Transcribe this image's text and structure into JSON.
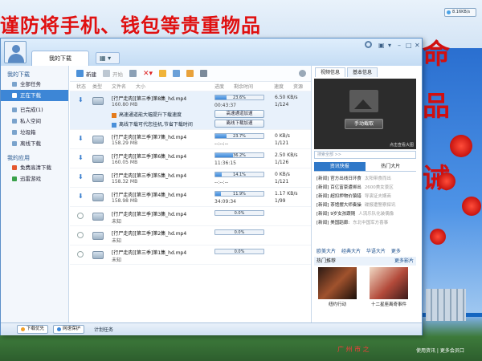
{
  "desktop": {
    "slogan": "谨防将手机、钱包等贵重物品",
    "big_chars": [
      "命",
      "品",
      "诫"
    ],
    "bottom_text": "广 州 市 之",
    "watermark": "S",
    "watermark_sub": "使用资讯 | 更多会员口"
  },
  "speed_widget": {
    "value": "8.16KB/s"
  },
  "window": {
    "tab_main": "我的下载",
    "tab_view_icon": "grid-icon"
  },
  "sidebar": {
    "my_downloads_header": "我的下载",
    "items": [
      {
        "label": "全部任务"
      },
      {
        "label": "正在下载"
      },
      {
        "label": "已完成(1)"
      },
      {
        "label": "私人空间"
      },
      {
        "label": "垃圾箱"
      },
      {
        "label": "离线下载"
      }
    ],
    "my_apps_header": "我的应用",
    "apps": [
      {
        "label": "免费高清下载"
      },
      {
        "label": "迅雷游戏"
      }
    ]
  },
  "toolbar": {
    "new_label": "新建",
    "start_label": "开始"
  },
  "columns": {
    "status": "状态",
    "type": "类型",
    "filename": "文件名",
    "size": "大小",
    "progress": "进度",
    "remaining": "剩余时间",
    "speed": "速度",
    "health": "资源"
  },
  "tasks": [
    {
      "name": "[行尸走肉][第三季]第8集_hd.mp4",
      "size": "160.80 MB",
      "progress": 23.6,
      "pct_label": "23.6%",
      "remaining": "00:43:37",
      "speed": "6.50 KB/s",
      "peers": "1/124",
      "state": "downloading"
    },
    {
      "name": "[行尸走肉][第三季]第7集_hd.mp4",
      "size": "158.29 MB",
      "progress": 23.7,
      "pct_label": "23.7%",
      "remaining": "--:--:--",
      "speed": "0 KB/s",
      "peers": "1/121",
      "state": "downloading"
    },
    {
      "name": "[行尸走肉][第三季]第6集_hd.mp4",
      "size": "160.05 MB",
      "progress": 36.2,
      "pct_label": "36.2%",
      "remaining": "11:36:15",
      "speed": "2.50 KB/s",
      "peers": "1/126",
      "state": "downloading"
    },
    {
      "name": "[行尸走肉][第三季]第5集_hd.mp4",
      "size": "158.32 MB",
      "progress": 14.1,
      "pct_label": "14.1%",
      "remaining": "--:--:--",
      "speed": "0 KB/s",
      "peers": "1/121",
      "state": "downloading"
    },
    {
      "name": "[行尸走肉][第三季]第4集_hd.mp4",
      "size": "158.98 MB",
      "progress": 11.9,
      "pct_label": "11.9%",
      "remaining": "34:09:34",
      "speed": "1.17 KB/s",
      "peers": "1/99",
      "state": "downloading"
    },
    {
      "name": "[行尸走肉][第三季]第3集_hd.mp4",
      "size": "未知",
      "progress": 0,
      "pct_label": "0.0%",
      "remaining": "",
      "speed": "",
      "peers": "",
      "state": "waiting"
    },
    {
      "name": "[行尸走肉][第三季]第2集_hd.mp4",
      "size": "未知",
      "progress": 0,
      "pct_label": "0.0%",
      "remaining": "",
      "speed": "",
      "peers": "",
      "state": "waiting"
    },
    {
      "name": "[行尸走肉][第三季]第1集_hd.mp4",
      "size": "未知",
      "progress": 0,
      "pct_label": "0.0%",
      "remaining": "",
      "speed": "",
      "peers": "",
      "state": "waiting"
    }
  ],
  "accel": {
    "line1": "高速通道能大幅提升下载速度",
    "line2": "离线下载可代您挂机,节省下载时间",
    "btn1": "高速通道加速",
    "btn2": "离线下载加速"
  },
  "rpanel": {
    "tab_video": "视频信息",
    "tab_basic": "基本信息",
    "snap_btn": "手动截取",
    "preview_hint": "点击查看大图",
    "search_placeholder": "搜索全部 >>",
    "tab_news": "资讯快报",
    "tab_hot": "热门大片",
    "news": [
      {
        "tag": "[新闻]",
        "text": "官方出线日环食",
        "side": "太阳带食而出"
      },
      {
        "tag": "[新闻]",
        "text": "百亿富豪遭绑出",
        "side": "2600美女景区"
      },
      {
        "tag": "[新闻]",
        "text": "超扣押物价猿猎",
        "side": "导演证夫婿商"
      },
      {
        "tag": "[新闻]",
        "text": "茶馆摆大师奏操",
        "side": "碟报遭警察探讯"
      },
      {
        "tag": "[新闻]",
        "text": "9岁女孩跟随",
        "side": "人流乐队化装偶像"
      },
      {
        "tag": "[新闻]",
        "text": "美国蹈廊:",
        "side": "东北中国军方喜事"
      }
    ],
    "links": [
      "欧美大片",
      "经典大片",
      "华语大片",
      "更多"
    ],
    "hot_title": "热门推荐",
    "hot_more": "更多影片",
    "thumbs": [
      {
        "caption": "纽约行动"
      },
      {
        "caption": "十二星座离奇事件"
      }
    ]
  },
  "statusbar": {
    "btn1": "下载优先",
    "btn2": "网速保护",
    "text": "计划任务"
  }
}
